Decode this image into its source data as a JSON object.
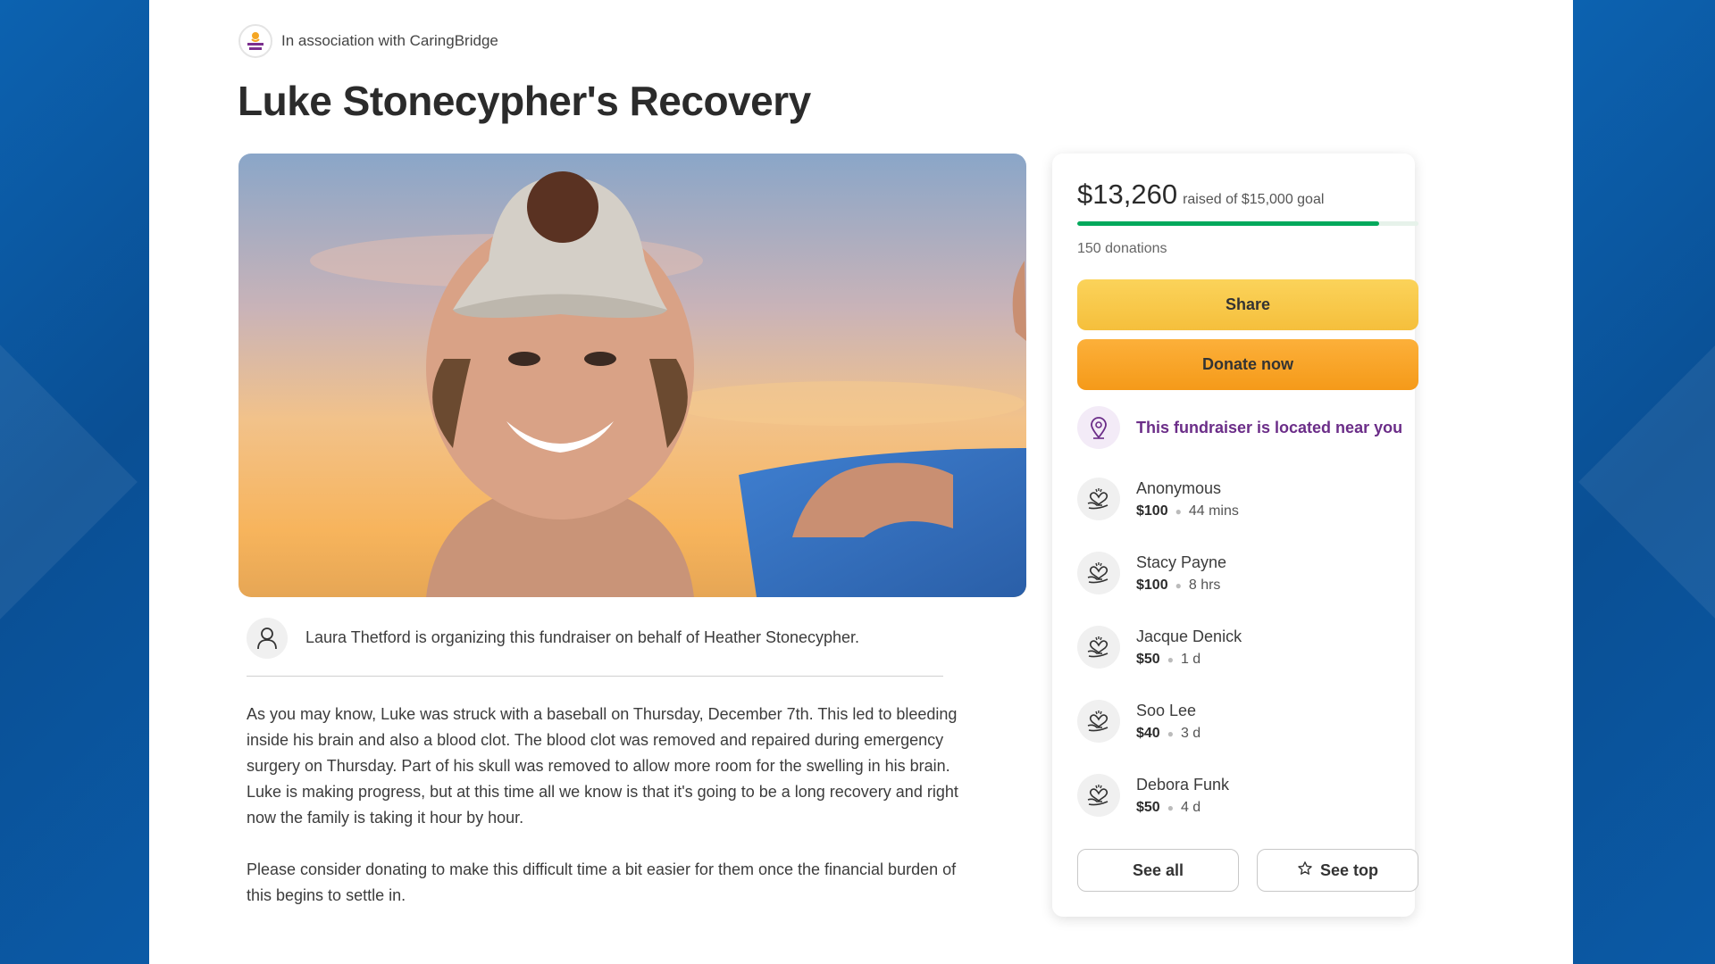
{
  "header": {
    "association_text": "In association with CaringBridge",
    "logo_icon": "caringbridge-logo",
    "title": "Luke Stonecypher's Recovery"
  },
  "hero": {
    "icon": "photo-of-smiling-young-man-in-cap"
  },
  "organizer": {
    "icon": "person-icon",
    "text": "Laura Thetford is organizing this fundraiser on behalf of Heather Stonecypher."
  },
  "story": {
    "paragraph1": "As you may know, Luke was struck with a baseball on Thursday, December 7th. This led to bleeding inside his brain and also a blood clot. The blood clot was removed and repaired during emergency surgery on Thursday. Part of his skull was removed to allow more room for the swelling in his brain.",
    "paragraph2": "Luke is making progress, but at this time all we know is that it's going to be a long recovery and right now the family is taking it hour by hour.",
    "paragraph3": "Please consider donating to make this difficult time a bit easier for them once the financial burden of this begins to settle in."
  },
  "donation_card": {
    "raised_amount": "$13,260",
    "raised_goal_text": "raised of $15,000 goal",
    "progress_fraction": 0.884,
    "progress_color": "#02a95c",
    "donations_count": "150 donations",
    "share_label": "Share",
    "donate_label": "Donate now",
    "near_you_text": "This fundraiser is located near you",
    "near_icon": "location-pin-icon",
    "donors": [
      {
        "name": "Anonymous",
        "amount": "$100",
        "time": "44 mins"
      },
      {
        "name": "Stacy Payne",
        "amount": "$100",
        "time": "8 hrs"
      },
      {
        "name": "Jacque Denick",
        "amount": "$50",
        "time": "1 d"
      },
      {
        "name": "Soo Lee",
        "amount": "$40",
        "time": "3 d"
      },
      {
        "name": "Debora Funk",
        "amount": "$50",
        "time": "4 d"
      }
    ],
    "donor_icon": "heart-hands-icon",
    "see_all_label": "See all",
    "see_top_label": "See top",
    "see_top_icon": "star-icon"
  }
}
